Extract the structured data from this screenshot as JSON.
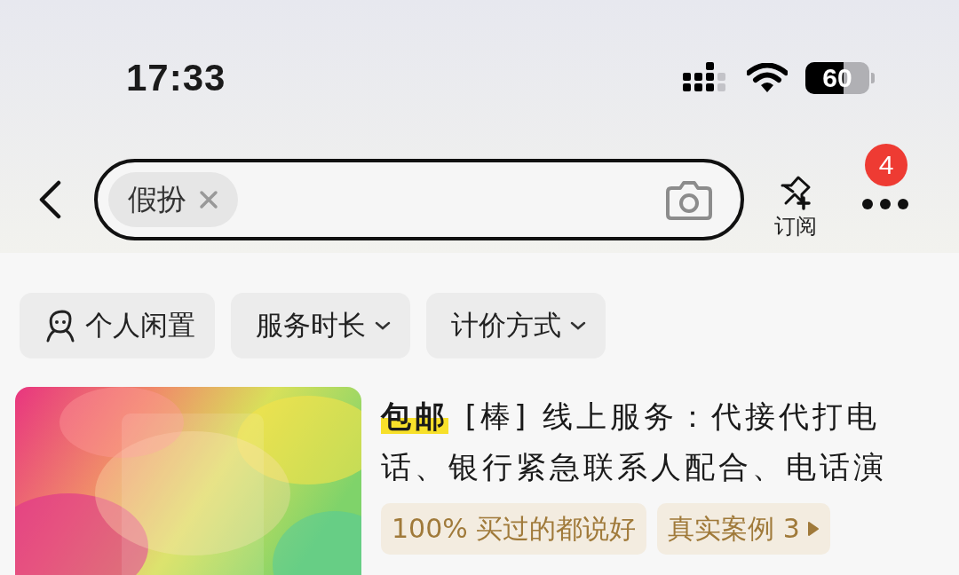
{
  "status_bar": {
    "time": "17:33",
    "battery": "60"
  },
  "search": {
    "chip": {
      "label": "假扮"
    }
  },
  "header_actions": {
    "subscribe": "订阅",
    "more_badge": "4"
  },
  "filters": [
    {
      "kind": "icon",
      "label": "个人闲置"
    },
    {
      "kind": "dropdown",
      "label": "服务时长"
    },
    {
      "kind": "dropdown",
      "label": "计价方式"
    }
  ],
  "listing": {
    "badge": "包邮",
    "title": "[棒]  线上服务：代接代打电话、银行紧急联系人配合、电话演",
    "tags": [
      {
        "kind": "plain",
        "label": "100% 买过的都说好"
      },
      {
        "kind": "link",
        "label": "真实案例 3"
      }
    ]
  }
}
